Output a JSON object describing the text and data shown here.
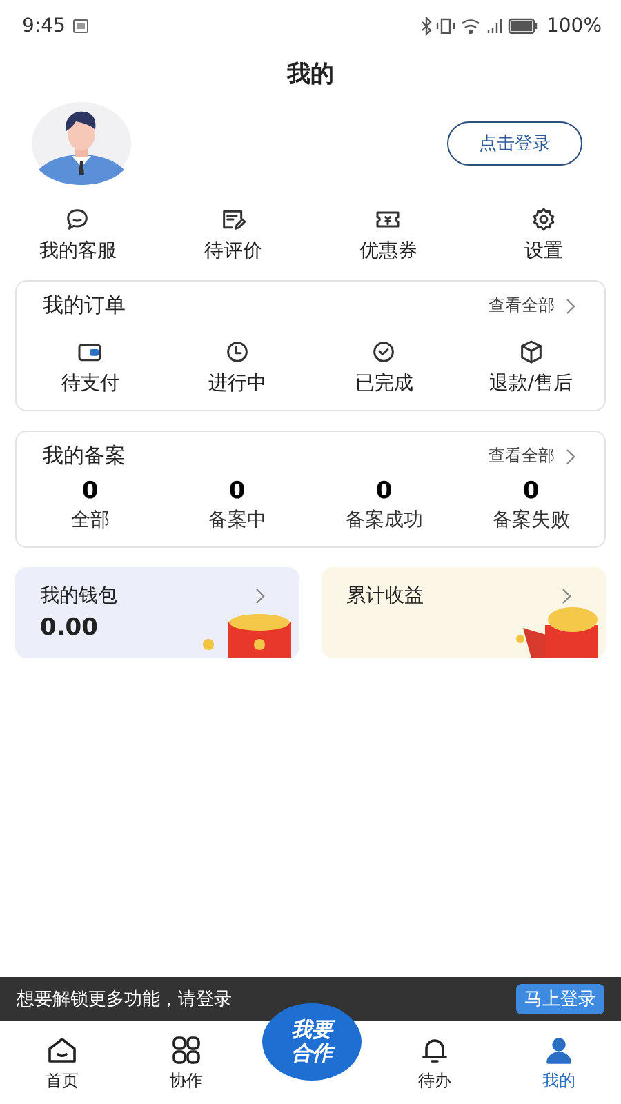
{
  "status_bar": {
    "time": "9:45",
    "battery": "100%"
  },
  "title": "我的",
  "login_button": "点击登录",
  "shortcuts": [
    {
      "kind": "chat",
      "label": "我的客服"
    },
    {
      "kind": "review",
      "label": "待评价"
    },
    {
      "kind": "coupon",
      "label": "优惠券"
    },
    {
      "kind": "gear",
      "label": "设置"
    }
  ],
  "orders": {
    "title": "我的订单",
    "view_all": "查看全部",
    "items": [
      {
        "kind": "wallet",
        "label": "待支付"
      },
      {
        "kind": "clock",
        "label": "进行中"
      },
      {
        "kind": "check",
        "label": "已完成"
      },
      {
        "kind": "box",
        "label": "退款/售后"
      }
    ]
  },
  "filings": {
    "title": "我的备案",
    "view_all": "查看全部",
    "items": [
      {
        "count": "0",
        "label": "全部"
      },
      {
        "count": "0",
        "label": "备案中"
      },
      {
        "count": "0",
        "label": "备案成功"
      },
      {
        "count": "0",
        "label": "备案失败"
      }
    ]
  },
  "wallet": {
    "title": "我的钱包",
    "amount": "0.00"
  },
  "earnings": {
    "title": "累计收益"
  },
  "login_banner": {
    "text": "想要解锁更多功能，请登录",
    "button": "马上登录"
  },
  "tab_bar": {
    "center_button": "我要合作",
    "tabs": [
      {
        "kind": "home",
        "label": "首页",
        "selected": false
      },
      {
        "kind": "grid",
        "label": "协作",
        "selected": false
      },
      {
        "kind": "bell",
        "label": "待办",
        "selected": false
      },
      {
        "kind": "person",
        "label": "我的",
        "selected": true
      }
    ]
  }
}
